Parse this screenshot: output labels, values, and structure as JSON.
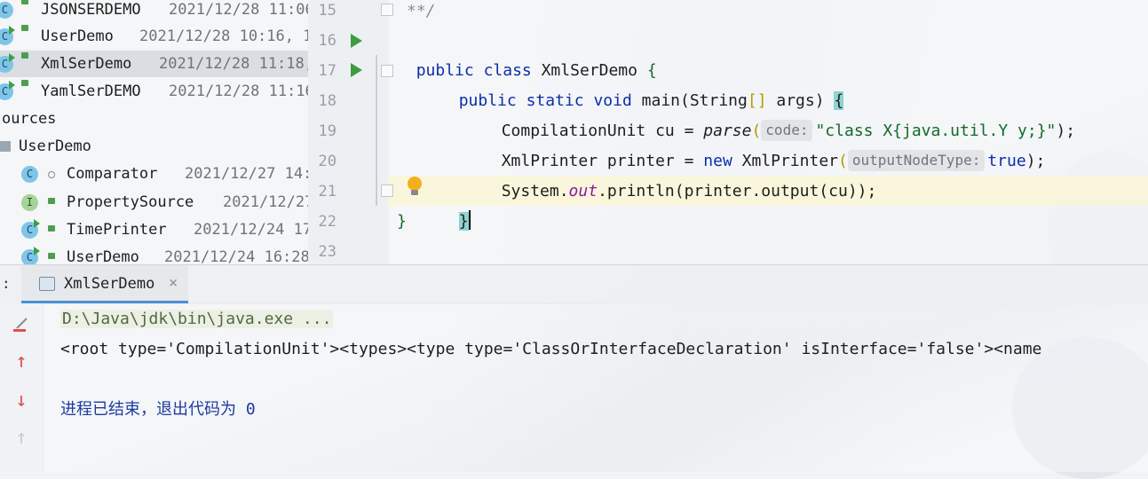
{
  "project_tree": {
    "items": [
      {
        "name": "JSONSERDEMO",
        "date": "2021/12/28 11:06",
        "icon": "class-icon"
      },
      {
        "name": "UserDemo",
        "date": "2021/12/28 10:16, 1",
        "icon": "runnable-class-icon"
      },
      {
        "name": "XmlSerDemo",
        "date": "2021/12/28 11:18,",
        "icon": "runnable-class-icon",
        "selected": true
      },
      {
        "name": "YamlSerDEMO",
        "date": "2021/12/28 11:16",
        "icon": "runnable-class-icon"
      },
      {
        "name": "ources",
        "date": "",
        "icon": "folder-icon"
      },
      {
        "name": "UserDemo",
        "date": "",
        "icon": "folder-icon"
      },
      {
        "name": "Comparator",
        "date": "2021/12/27 14:",
        "icon": "class-icon"
      },
      {
        "name": "PropertySource",
        "date": "2021/12/27",
        "icon": "interface-icon"
      },
      {
        "name": "TimePrinter",
        "date": "2021/12/24 17",
        "icon": "runnable-class-icon"
      },
      {
        "name": "UserDemo",
        "date": "2021/12/24 16:28",
        "icon": "runnable-class-icon"
      }
    ],
    "class_letter": "C",
    "interface_letter": "I"
  },
  "editor": {
    "line_numbers": [
      "15",
      "16",
      "17",
      "18",
      "19",
      "20",
      "21",
      "22",
      "23"
    ],
    "line15_comment": "**/",
    "line16": {
      "kw1": "public",
      "kw2": "class",
      "name": "XmlSerDemo",
      "brace": "{"
    },
    "line17": {
      "kw1": "public",
      "kw2": "static",
      "kw3": "void",
      "name": "main",
      "params_start": "(String",
      "brackets": "[]",
      "params_end": " args)",
      "brace": "{"
    },
    "line18": {
      "pre": "CompilationUnit cu = ",
      "method": "parse",
      "open": "(",
      "hint": "code:",
      "string": "\"class X{java.util.Y y;}\"",
      "close": ");"
    },
    "line19": {
      "pre": "XmlPrinter printer = ",
      "kw": "new",
      "cls": " XmlPrinter",
      "open": "(",
      "hint": "outputNodeType:",
      "value": "true",
      "close": ");"
    },
    "line20": {
      "pre": "System.",
      "field": "out",
      "mid": ".println(printer.output(cu));"
    },
    "line21_brace": "}",
    "line22_brace": "}"
  },
  "run_window": {
    "prefix": ":",
    "tab_label": "XmlSerDemo",
    "tab_close": "×",
    "output": {
      "command": "D:\\Java\\jdk\\bin\\java.exe ...",
      "result": "<root type='CompilationUnit'><types><type type='ClassOrInterfaceDeclaration' isInterface='false'><name",
      "exit": "进程已结束，退出代码为 0"
    }
  }
}
